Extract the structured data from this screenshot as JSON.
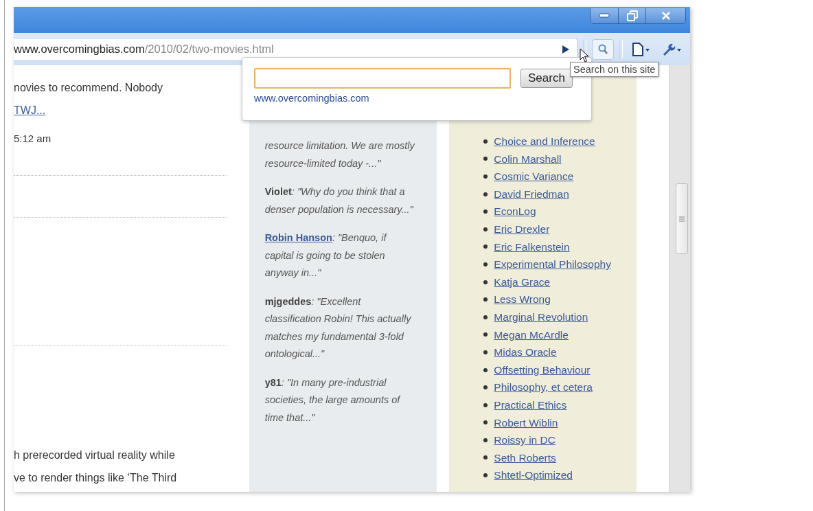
{
  "toolbar": {
    "address": {
      "host": "www.overcomingbias.com",
      "path": "/2010/02/two-movies.html"
    }
  },
  "search_popup": {
    "button": "Search",
    "site": "www.overcomingbias.com"
  },
  "tooltip": "Search on this site",
  "post_column": {
    "lines": [
      {
        "kind": "text",
        "text": "novies to recommend. Nobody"
      },
      {
        "kind": "link",
        "text": "TWJ..."
      },
      {
        "kind": "time",
        "text": "5:12 am"
      },
      {
        "kind": "rule"
      },
      {
        "kind": "rule"
      },
      {
        "kind": "gap"
      },
      {
        "kind": "rule"
      },
      {
        "kind": "gap"
      },
      {
        "kind": "text",
        "text": "h prerecorded virtual reality while"
      },
      {
        "kind": "text",
        "text": "ve to render things like ‘The Third"
      }
    ]
  },
  "comments": [
    {
      "text": "resource limitation. We are mostly resource-limited today -...\""
    },
    {
      "author": "Violet",
      "author_link": false,
      "text": ": \"Why do you think that a denser population is necessary...\""
    },
    {
      "author": "Robin Hanson",
      "author_link": true,
      "text": ": \"Benquo, if capital is going to be stolen anyway in...\""
    },
    {
      "author": "mjgeddes",
      "author_link": false,
      "text": ": \"Excellent classification Robin! This actually matches my fundamental 3-fold ontological...\""
    },
    {
      "author": "y81",
      "author_link": false,
      "text": ": \"In many pre-industrial societies, the large amounts of time that...\""
    }
  ],
  "blogroll": [
    "Choice and Inference",
    "Colin Marshall",
    "Cosmic Variance",
    "David Friedman",
    "EconLog",
    "Eric Drexler",
    "Eric Falkenstein",
    "Experimental Philosophy",
    "Katja Grace",
    "Less Wrong",
    "Marginal Revolution",
    "Megan McArdle",
    "Midas Oracle",
    "Offsetting Behaviour",
    "Philosophy, et cetera",
    "Practical Ethics",
    "Robert Wiblin",
    "Roissy in DC",
    "Seth Roberts",
    "Shtetl-Optimized"
  ]
}
